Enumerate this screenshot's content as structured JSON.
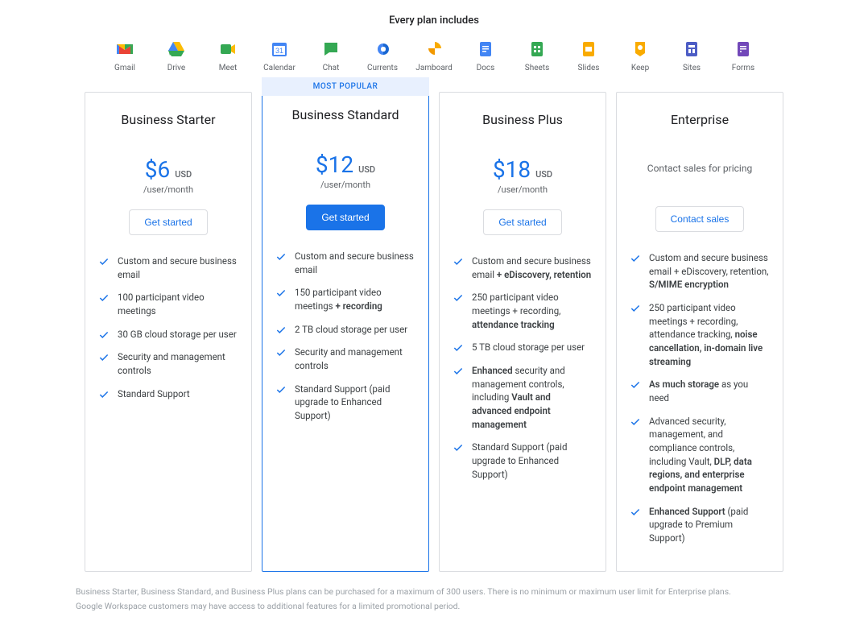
{
  "header": "Every plan includes",
  "apps": [
    "Gmail",
    "Drive",
    "Meet",
    "Calendar",
    "Chat",
    "Currents",
    "Jamboard",
    "Docs",
    "Sheets",
    "Slides",
    "Keep",
    "Sites",
    "Forms"
  ],
  "popular_badge": "MOST POPULAR",
  "plans": [
    {
      "title": "Business Starter",
      "price": "$6",
      "currency": "USD",
      "per": "/user/month",
      "cta": "Get started",
      "features": [
        "Custom and secure business email",
        "100 participant video meetings",
        "30 GB cloud storage per user",
        "Security and management controls",
        "Standard Support"
      ]
    },
    {
      "title": "Business Standard",
      "price": "$12",
      "currency": "USD",
      "per": "/user/month",
      "cta": "Get started",
      "features": [
        "Custom and secure business email",
        "150 participant video meetings <strong>+ recording</strong>",
        "2 TB cloud storage per user",
        "Security and management controls",
        "Standard Support (paid upgrade to Enhanced Support)"
      ]
    },
    {
      "title": "Business Plus",
      "price": "$18",
      "currency": "USD",
      "per": "/user/month",
      "cta": "Get started",
      "features": [
        "Custom and secure business email <strong>+ eDiscovery, retention</strong>",
        "250 participant video meetings + recording, <strong>attendance tracking</strong>",
        "5 TB cloud storage per user",
        "<strong>Enhanced</strong> security and management controls, including <strong>Vault and advanced endpoint management</strong>",
        "Standard Support (paid upgrade to Enhanced Support)"
      ]
    },
    {
      "title": "Enterprise",
      "contact_text": "Contact sales for pricing",
      "cta": "Contact sales",
      "features": [
        "Custom and secure business email + eDiscovery, retention, <strong>S/MIME encryption</strong>",
        "250 participant video meetings + recording, attendance tracking, <strong>noise cancellation, in-domain live streaming</strong>",
        "<strong>As much storage</strong> as you need",
        "Advanced security, management, and compliance controls, including Vault, <strong>DLP, data regions, and enterprise endpoint management</strong>",
        "<strong>Enhanced Support</strong> (paid upgrade to Premium Support)"
      ]
    }
  ],
  "footnotes": [
    "Business Starter, Business Standard, and Business Plus plans can be purchased for a maximum of 300 users. There is no minimum or maximum user limit for Enterprise plans.",
    "Google Workspace customers may have access to additional features for a limited promotional period."
  ]
}
